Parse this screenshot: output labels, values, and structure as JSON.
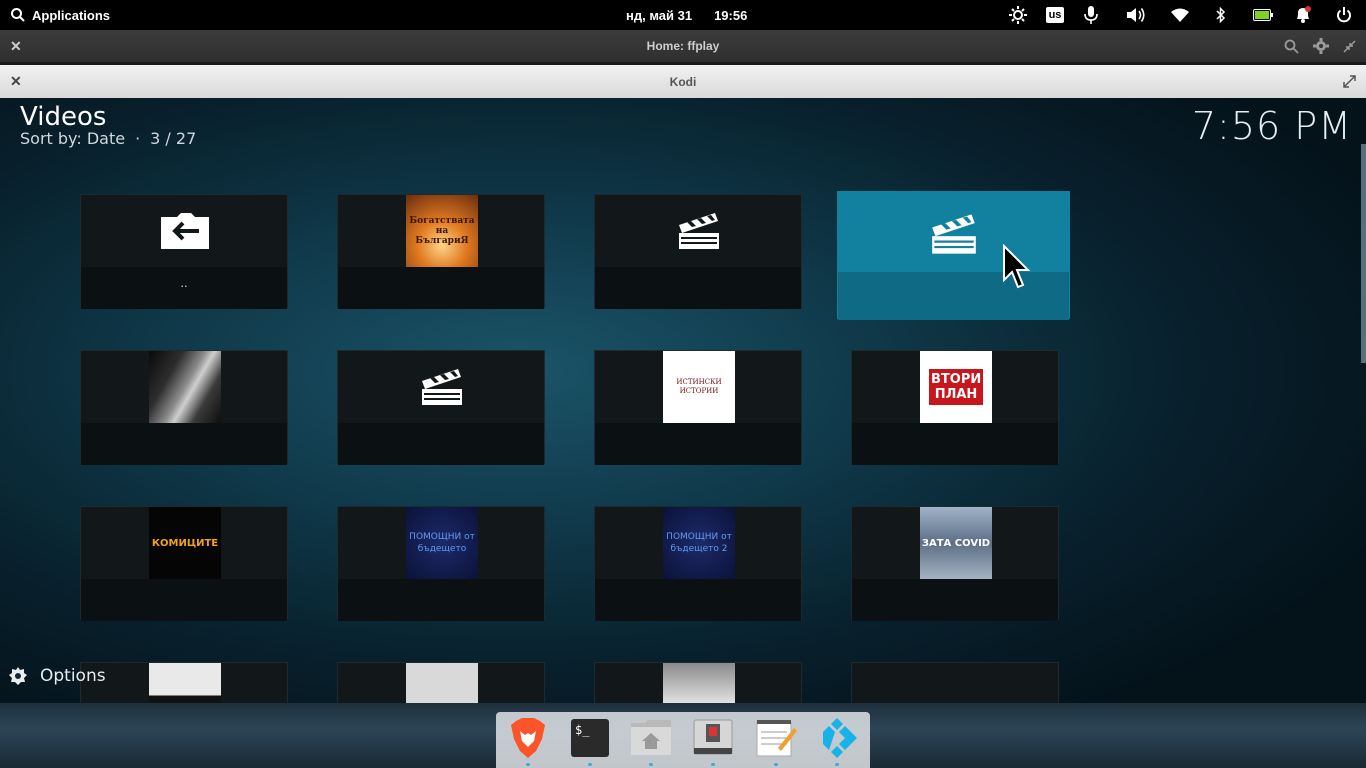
{
  "panel": {
    "apps_label": "Applications",
    "date": "нд, май 31",
    "time": "19:56",
    "keyboard_layout": "us"
  },
  "windows": {
    "outer_title": "Home: ffplay",
    "inner_title": "Kodi"
  },
  "kodi": {
    "title": "Videos",
    "sort_label": "Sort by: Date",
    "position": "3 / 27",
    "clock": "7:56 PM",
    "options_label": "Options",
    "tiles": [
      {
        "kind": "parent-folder",
        "label": ".."
      },
      {
        "kind": "thumb",
        "thumb_text": "Богатствата на БългариЯ"
      },
      {
        "kind": "clapper"
      },
      {
        "kind": "clapper",
        "focused": true
      },
      {
        "kind": "thumb",
        "thumb_text": ""
      },
      {
        "kind": "clapper"
      },
      {
        "kind": "thumb",
        "thumb_text": "ИСТИНСКИ ИСТОРИИ"
      },
      {
        "kind": "thumb",
        "thumb_text": "ВТОРИ ПЛАН"
      },
      {
        "kind": "thumb",
        "thumb_text": "КОМИЦИТЕ"
      },
      {
        "kind": "thumb",
        "thumb_text": "ПОМОЩНИ от бъдещето"
      },
      {
        "kind": "thumb",
        "thumb_text": "ПОМОЩНИ от бъдещето 2"
      },
      {
        "kind": "thumb",
        "thumb_text": "ЗАТА COVID"
      }
    ]
  },
  "dock": {
    "items": [
      "brave-browser",
      "terminal",
      "files",
      "system-settings",
      "text-editor",
      "kodi"
    ]
  },
  "colors": {
    "focus": "#12809f",
    "accent_dot": "#3fa9d9"
  }
}
